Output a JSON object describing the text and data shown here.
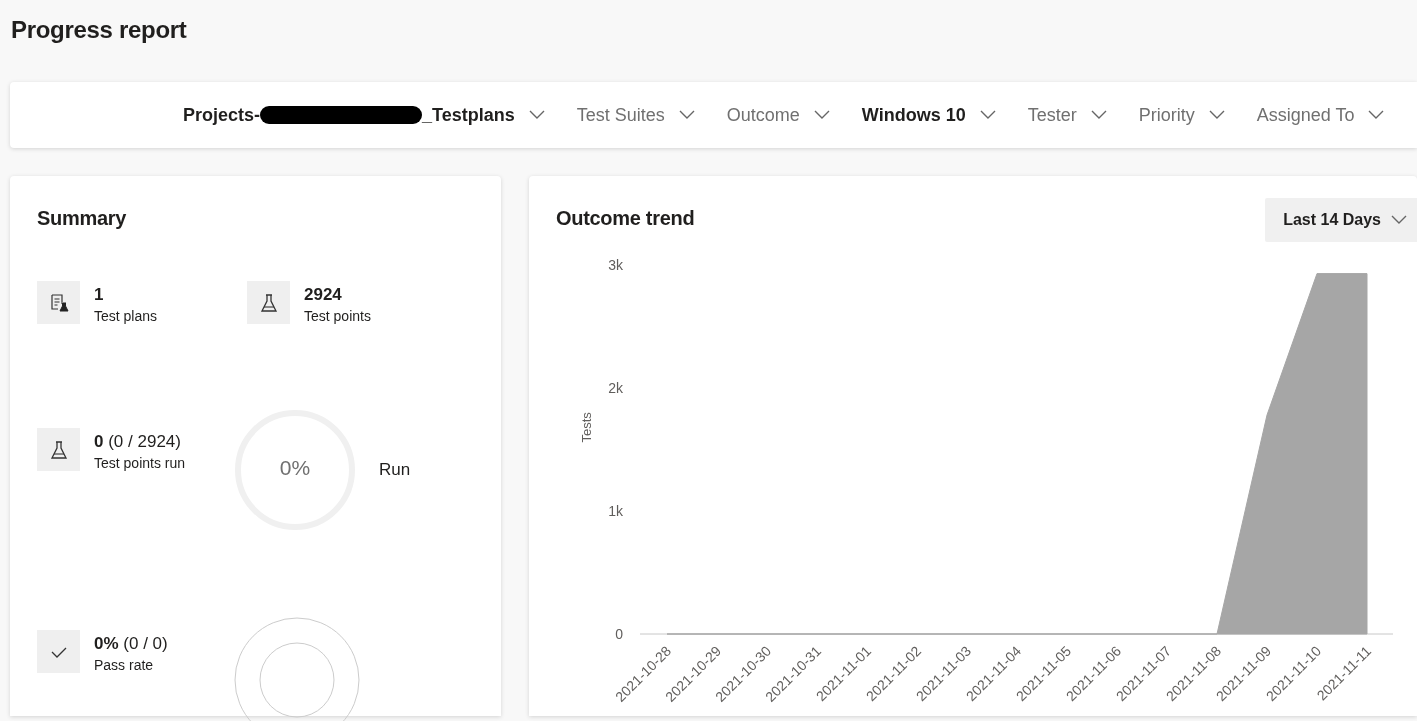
{
  "page": {
    "title": "Progress report"
  },
  "filters": [
    {
      "label": "Projects-",
      "label_end": "_Testplans",
      "redacted": true,
      "active": true
    },
    {
      "label": "Test Suites",
      "active": false
    },
    {
      "label": "Outcome",
      "active": false
    },
    {
      "label": "Windows 10",
      "active": true
    },
    {
      "label": "Tester",
      "active": false
    },
    {
      "label": "Priority",
      "active": false
    },
    {
      "label": "Assigned To",
      "active": false
    }
  ],
  "summary": {
    "title": "Summary",
    "stats": [
      {
        "kind": "plan",
        "value": "1",
        "label": "Test plans"
      },
      {
        "kind": "flask",
        "value": "2924",
        "label": "Test points"
      }
    ],
    "run": {
      "kind": "flask",
      "value": "0",
      "detail": "(0 / 2924)",
      "label": "Test points run",
      "ring_text": "0%",
      "ring_label": "Run"
    },
    "pass": {
      "kind": "check",
      "value": "0%",
      "detail": "(0 / 0)",
      "label": "Pass rate"
    }
  },
  "trend": {
    "title": "Outcome trend",
    "range": "Last 14 Days",
    "chart_data": {
      "type": "area",
      "ylabel": "Tests",
      "categories": [
        "2021-10-28",
        "2021-10-29",
        "2021-10-30",
        "2021-10-31",
        "2021-11-01",
        "2021-11-02",
        "2021-11-03",
        "2021-11-04",
        "2021-11-05",
        "2021-11-06",
        "2021-11-07",
        "2021-11-08",
        "2021-11-09",
        "2021-11-10",
        "2021-11-11"
      ],
      "series": [
        {
          "color": "#a6a6a6",
          "values": [
            0,
            0,
            0,
            0,
            0,
            0,
            0,
            0,
            0,
            0,
            0,
            0,
            1780,
            2930,
            2930
          ]
        }
      ],
      "ylim": [
        0,
        3000
      ],
      "yticks": [
        {
          "value": 0,
          "label": "0"
        },
        {
          "value": 1000,
          "label": "1k"
        },
        {
          "value": 2000,
          "label": "2k"
        },
        {
          "value": 3000,
          "label": "3k"
        }
      ]
    }
  }
}
